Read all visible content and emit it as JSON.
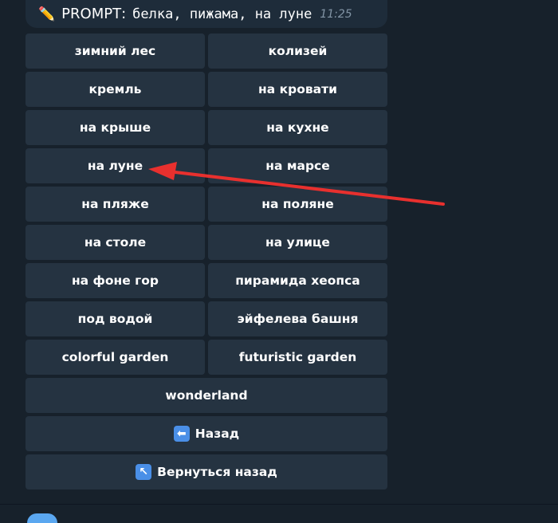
{
  "message": {
    "icon": "pencil-emoji",
    "label": "PROMPT",
    "colon": ":",
    "text": "белка, пижама, на луне",
    "time": "11:25"
  },
  "keyboard": {
    "rows": [
      [
        "зимний лес",
        "колизей"
      ],
      [
        "кремль",
        "на кровати"
      ],
      [
        "на крыше",
        "на кухне"
      ],
      [
        "на луне",
        "на марсе"
      ],
      [
        "на пляже",
        "на поляне"
      ],
      [
        "на столе",
        "на улице"
      ],
      [
        "на фоне гор",
        "пирамида хеопса"
      ],
      [
        "под водой",
        "эйфелева башня"
      ],
      [
        "colorful garden",
        "futuristic garden"
      ]
    ],
    "wonderland": "wonderland",
    "back": {
      "icon": "left-arrow-emoji",
      "label": "Назад"
    },
    "return": {
      "icon": "up-left-arrow-emoji",
      "label": "Вернуться назад"
    }
  },
  "annotation": {
    "color": "#e8302e"
  }
}
